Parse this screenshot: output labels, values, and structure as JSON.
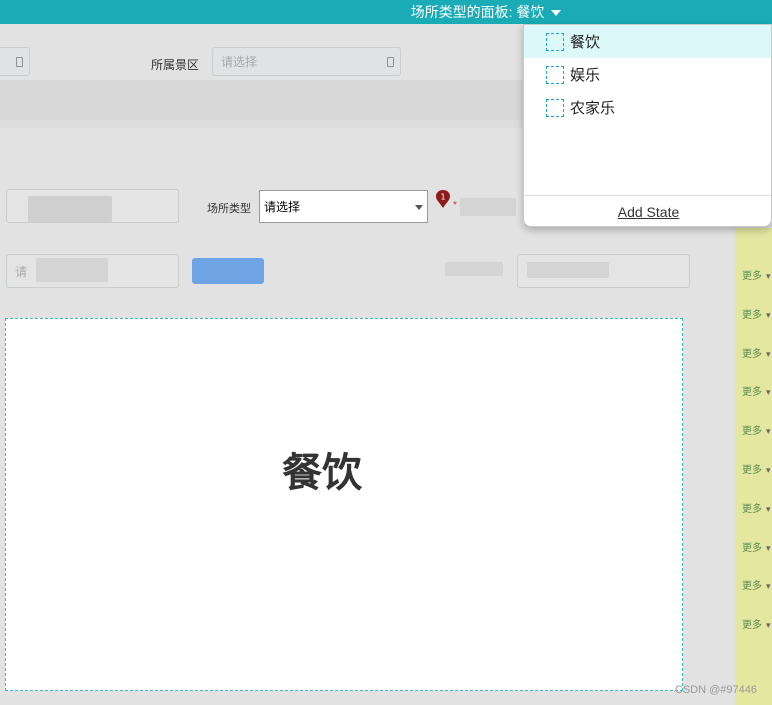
{
  "topbar": {
    "panel_title": "场所类型的面板: 餐饮",
    "color": "#19acb6"
  },
  "form": {
    "scenic_area_label": "所属景区",
    "scenic_area_placeholder": "请选择",
    "place_type_label": "场所类型",
    "place_type_value": "请选择",
    "input_placeholder_1": "请",
    "input_placeholder_2": "",
    "error_badge": "1",
    "required_mark": "*"
  },
  "state_panel": {
    "label": "餐饮",
    "border_color": "#2fb8c6"
  },
  "dropdown": {
    "items": [
      {
        "label": "餐饮",
        "active": true
      },
      {
        "label": "娱乐",
        "active": false
      },
      {
        "label": "农家乐",
        "active": false
      }
    ],
    "add_state_label": "Add State"
  },
  "right_column": {
    "more_items": [
      "更多",
      "更多",
      "更多",
      "更多",
      "更多",
      "更多",
      "更多",
      "更多",
      "更多",
      "更多"
    ]
  },
  "watermark": "CSDN @#97446"
}
